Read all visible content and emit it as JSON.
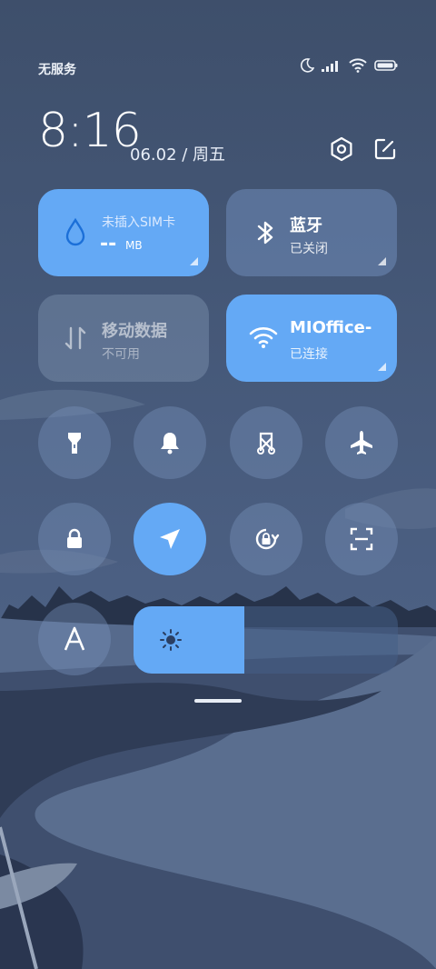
{
  "status": {
    "carrier": "无服务",
    "icons": [
      "moon-icon",
      "signal-icon",
      "wifi-icon",
      "battery-icon"
    ]
  },
  "header": {
    "time": "8:16",
    "date": "06.02 / 周五",
    "icons": [
      "settings-icon",
      "edit-icon"
    ]
  },
  "tiles": {
    "sim": {
      "title": "未插入SIM卡",
      "data_value": "--",
      "data_unit": "MB",
      "icon": "water-drop-icon"
    },
    "bluetooth": {
      "title": "蓝牙",
      "status": "已关闭",
      "icon": "bluetooth-icon"
    },
    "mobile_data": {
      "title": "移动数据",
      "status": "不可用",
      "icon": "data-arrows-icon"
    },
    "wifi": {
      "title": "MIOffice-",
      "status": "已连接",
      "icon": "wifi-icon"
    }
  },
  "toggles": [
    {
      "name": "flashlight",
      "icon": "flashlight-icon",
      "on": false
    },
    {
      "name": "bell",
      "icon": "bell-icon",
      "on": false
    },
    {
      "name": "screenshot",
      "icon": "scissors-icon",
      "on": false
    },
    {
      "name": "airplane",
      "icon": "airplane-icon",
      "on": false
    },
    {
      "name": "lock",
      "icon": "lock-icon",
      "on": false
    },
    {
      "name": "location",
      "icon": "location-arrow-icon",
      "on": true
    },
    {
      "name": "rotation-lock",
      "icon": "rotation-lock-icon",
      "on": false
    },
    {
      "name": "scanner",
      "icon": "scan-icon",
      "on": false
    },
    {
      "name": "font-size",
      "icon": "letter-a-icon",
      "on": false
    }
  ],
  "brightness": {
    "level": 0.42,
    "icon": "sun-icon"
  },
  "colors": {
    "accent": "#64a9f5",
    "background": "#46597a"
  }
}
